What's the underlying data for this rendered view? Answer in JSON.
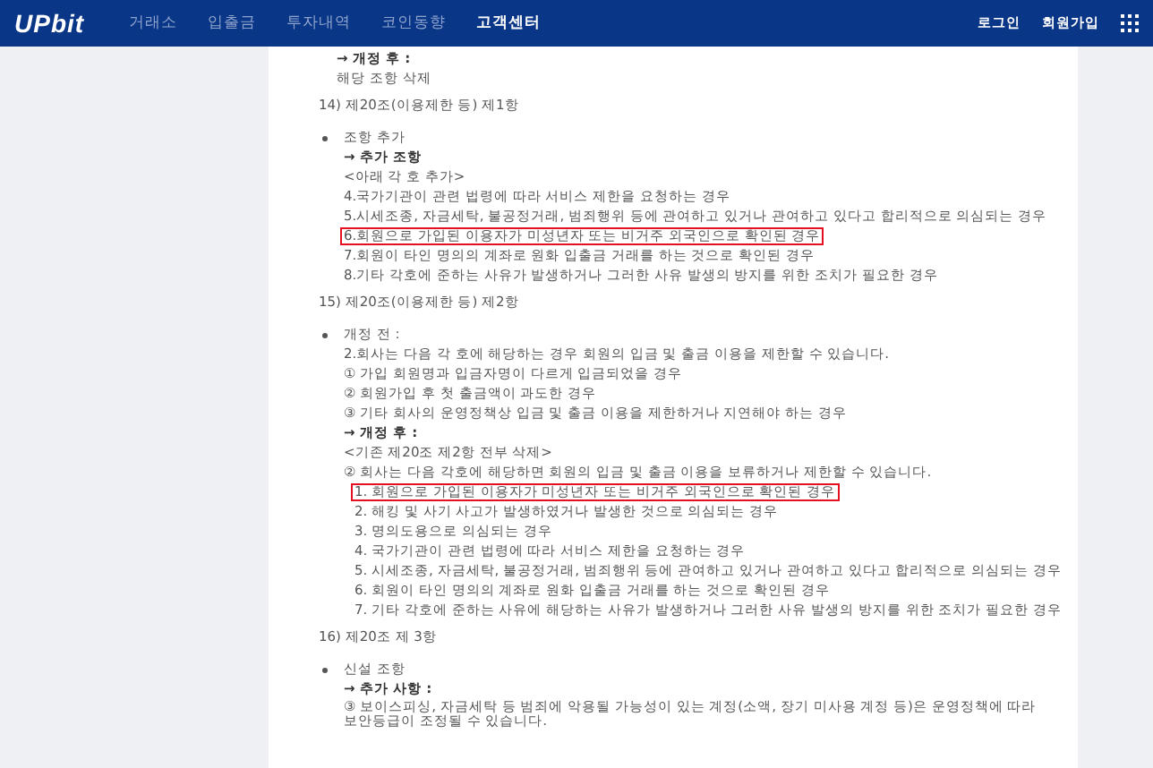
{
  "nav": {
    "logo": "UPbit",
    "menu": [
      {
        "label": "거래소",
        "selected": false
      },
      {
        "label": "입출금",
        "selected": false
      },
      {
        "label": "투자내역",
        "selected": false
      },
      {
        "label": "코인동향",
        "selected": false
      },
      {
        "label": "고객센터",
        "selected": true
      }
    ],
    "links": [
      "로그인",
      "회원가입"
    ]
  },
  "intro": [
    {
      "kind": "label",
      "text": "→ 개정 후 :",
      "highlighted": false
    },
    {
      "kind": "text",
      "text": "해당 조항 삭제",
      "highlighted": false
    }
  ],
  "sections": [
    {
      "heading": "14) 제20조(이용제한 등) 제1항",
      "bullets": [
        {
          "lines": [
            {
              "kind": "text",
              "text": "조항 추가",
              "highlighted": false
            },
            {
              "kind": "label",
              "text": "→ 추가 조항",
              "highlighted": false
            },
            {
              "kind": "text",
              "text": "<아래 각 호 추가>",
              "highlighted": false
            },
            {
              "kind": "text",
              "text": "4.국가기관이 관련 법령에 따라 서비스 제한을 요청하는 경우",
              "highlighted": false
            },
            {
              "kind": "text",
              "text": "5.시세조종, 자금세탁, 불공정거래, 범죄행위 등에 관여하고 있거나 관여하고 있다고 합리적으로 의심되는 경우",
              "highlighted": false
            },
            {
              "kind": "text",
              "text": "6.회원으로 가입된 이용자가 미성년자 또는 비거주 외국인으로 확인된 경우",
              "highlighted": true
            },
            {
              "kind": "text",
              "text": "7.회원이 타인 명의의 계좌로 원화 입출금 거래를 하는 것으로 확인된 경우",
              "highlighted": false
            },
            {
              "kind": "text",
              "text": "8.기타 각호에 준하는 사유가 발생하거나 그러한 사유 발생의 방지를 위한 조치가 필요한 경우",
              "highlighted": false
            }
          ]
        }
      ]
    },
    {
      "heading": "15) 제20조(이용제한 등) 제2항",
      "bullets": [
        {
          "lines": [
            {
              "kind": "text",
              "text": "개정 전 :",
              "highlighted": false
            },
            {
              "kind": "text",
              "text": "2.회사는 다음 각 호에 해당하는 경우 회원의 입금 및 출금 이용을 제한할 수 있습니다.",
              "highlighted": false
            },
            {
              "kind": "text",
              "text": "① 가입 회원명과 입금자명이 다르게 입금되었을 경우",
              "highlighted": false
            },
            {
              "kind": "text",
              "text": "② 회원가입 후 첫 출금액이 과도한 경우",
              "highlighted": false
            },
            {
              "kind": "text",
              "text": "③ 기타 회사의 운영정책상 입금 및 출금 이용을 제한하거나 지연해야 하는 경우",
              "highlighted": false
            },
            {
              "kind": "label",
              "text": "→ 개정 후 :",
              "highlighted": false
            },
            {
              "kind": "text",
              "text": "<기존 제20조 제2항 전부 삭제>",
              "highlighted": false
            },
            {
              "kind": "text",
              "text": "② 회사는 다음 각호에 해당하면 회원의 입금 및 출금 이용을 보류하거나 제한할 수 있습니다.",
              "highlighted": false
            },
            {
              "kind": "item",
              "text": "1. 회원으로 가입된 이용자가 미성년자 또는 비거주 외국인으로 확인된 경우",
              "highlighted": true
            },
            {
              "kind": "item",
              "text": "2. 해킹 및 사기 사고가 발생하였거나 발생한 것으로 의심되는 경우",
              "highlighted": false
            },
            {
              "kind": "item",
              "text": "3. 명의도용으로 의심되는 경우",
              "highlighted": false
            },
            {
              "kind": "item",
              "text": "4. 국가기관이 관련 법령에 따라 서비스 제한을 요청하는 경우",
              "highlighted": false
            },
            {
              "kind": "item",
              "text": "5. 시세조종, 자금세탁, 불공정거래, 범죄행위 등에 관여하고 있거나 관여하고 있다고 합리적으로 의심되는 경우",
              "highlighted": false
            },
            {
              "kind": "item",
              "text": "6. 회원이 타인 명의의 계좌로 원화 입출금 거래를 하는 것으로 확인된 경우",
              "highlighted": false
            },
            {
              "kind": "item",
              "text": "7. 기타 각호에 준하는 사유에 해당하는 사유가 발생하거나 그러한 사유 발생의 방지를 위한 조치가 필요한 경우",
              "highlighted": false
            }
          ]
        }
      ]
    },
    {
      "heading": "16) 제20조 제 3항",
      "bullets": [
        {
          "lines": [
            {
              "kind": "text",
              "text": "신설 조항",
              "highlighted": false
            },
            {
              "kind": "label",
              "text": "→ 추가 사항 :",
              "highlighted": false
            },
            {
              "kind": "text",
              "text": "③ 보이스피싱, 자금세탁 등 범죄에 악용될 가능성이 있는 계정(소액, 장기 미사용 계정 등)은 운영정책에 따라 보안등급이 조정될 수 있습니다.",
              "highlighted": false
            }
          ]
        }
      ]
    }
  ]
}
